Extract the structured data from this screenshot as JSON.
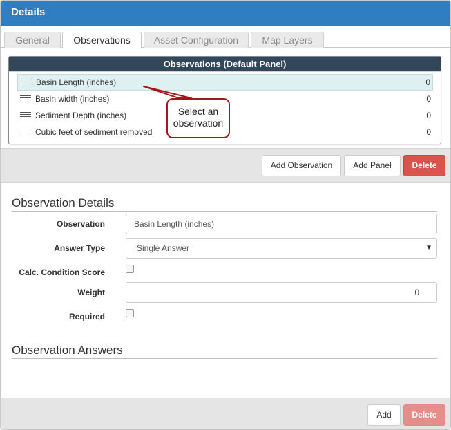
{
  "header": {
    "title": "Details"
  },
  "tabs": [
    {
      "label": "General",
      "active": false
    },
    {
      "label": "Observations",
      "active": true
    },
    {
      "label": "Asset Configuration",
      "active": false
    },
    {
      "label": "Map Layers",
      "active": false
    }
  ],
  "observations_panel": {
    "title": "Observations (Default Panel)",
    "items": [
      {
        "label": "Basin Length (inches)",
        "count": "0",
        "selected": true
      },
      {
        "label": "Basin width (inches)",
        "count": "0",
        "selected": false
      },
      {
        "label": "Sediment Depth (inches)",
        "count": "0",
        "selected": false
      },
      {
        "label": "Cubic feet of sediment removed",
        "count": "0",
        "selected": false
      }
    ]
  },
  "callout": {
    "line1": "Select an",
    "line2": "observation",
    "border_color": "#a01818"
  },
  "panel_toolbar": {
    "add_observation": "Add Observation",
    "add_panel": "Add Panel",
    "delete": "Delete"
  },
  "observation_details": {
    "title": "Observation Details",
    "observation_label": "Observation",
    "observation_value": "Basin Length (inches)",
    "answer_type_label": "Answer Type",
    "answer_type_value": "Single Answer",
    "calc_condition_label": "Calc. Condition Score",
    "calc_condition_checked": false,
    "weight_label": "Weight",
    "weight_value": "0",
    "required_label": "Required",
    "required_checked": false
  },
  "observation_answers": {
    "title": "Observation Answers",
    "add": "Add",
    "delete": "Delete"
  },
  "colors": {
    "header_bg": "#2f7ec1",
    "panel_title_bg": "#33475b",
    "selected_row_bg": "#dff0f0",
    "danger": "#d9534f"
  }
}
